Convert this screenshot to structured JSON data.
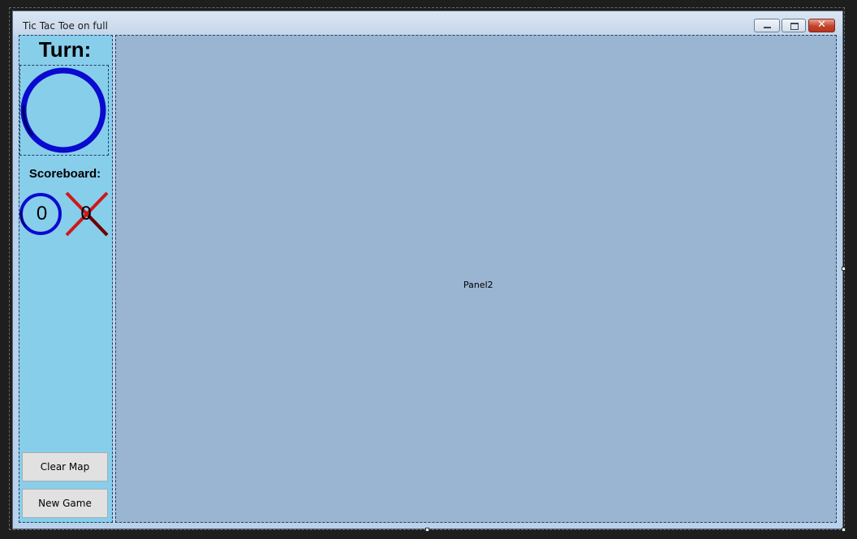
{
  "window": {
    "title": "Tic Tac Toe on full",
    "minimize_icon": "minimize-icon",
    "maximize_icon": "maximize-icon",
    "close_icon": "close-icon",
    "close_glyph": "✕"
  },
  "sidebar": {
    "turn_label": "Turn:",
    "current_turn_icon": "o-icon",
    "scoreboard_label": "Scoreboard:",
    "score_o": "0",
    "score_x": "0",
    "clear_map_label": "Clear Map",
    "new_game_label": "New Game"
  },
  "panel2": {
    "label": "Panel2"
  },
  "colors": {
    "sidebar_bg": "#87ceeb",
    "panel_bg": "#9ab5d2",
    "o_color": "#0000cd",
    "x_color": "#d01818"
  }
}
